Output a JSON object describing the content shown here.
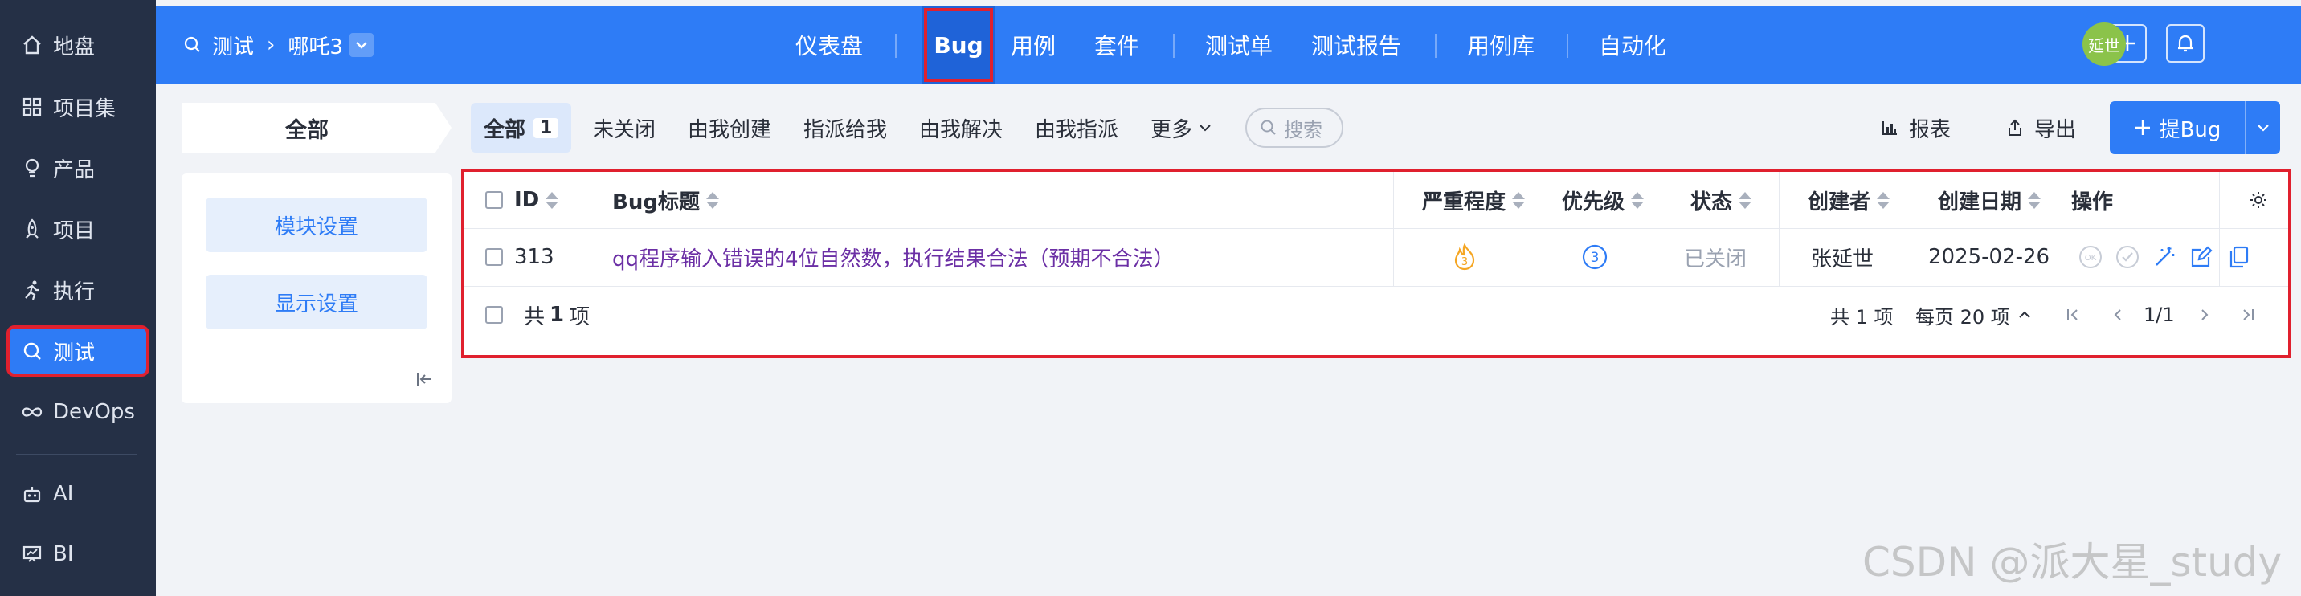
{
  "sidebar": {
    "items": [
      {
        "label": "地盘",
        "icon": "home-icon"
      },
      {
        "label": "项目集",
        "icon": "grid-icon"
      },
      {
        "label": "产品",
        "icon": "bulb-icon"
      },
      {
        "label": "项目",
        "icon": "rocket-icon"
      },
      {
        "label": "执行",
        "icon": "run-icon"
      },
      {
        "label": "测试",
        "icon": "search-icon",
        "active": true
      },
      {
        "label": "DevOps",
        "icon": "infinity-icon"
      },
      {
        "label": "AI",
        "icon": "robot-icon"
      },
      {
        "label": "BI",
        "icon": "chart-board-icon"
      }
    ]
  },
  "topbar": {
    "breadcrumb": {
      "section": "测试",
      "product": "哪吒3"
    },
    "nav": [
      "仪表盘",
      "Bug",
      "用例",
      "套件",
      "测试单",
      "测试报告",
      "用例库",
      "自动化"
    ],
    "active_nav": "Bug",
    "avatar_text": "延世"
  },
  "filterbar": {
    "all_label": "全部",
    "tabs": [
      {
        "label": "全部",
        "count": "1",
        "active": true
      },
      {
        "label": "未关闭"
      },
      {
        "label": "由我创建"
      },
      {
        "label": "指派给我"
      },
      {
        "label": "由我解决"
      },
      {
        "label": "由我指派"
      },
      {
        "label": "更多"
      }
    ],
    "search_placeholder": "搜索",
    "report_label": "报表",
    "export_label": "导出",
    "add_bug_label": "提Bug"
  },
  "leftpanel": {
    "module_settings": "模块设置",
    "display_settings": "显示设置"
  },
  "table": {
    "columns": [
      "ID",
      "Bug标题",
      "严重程度",
      "优先级",
      "状态",
      "创建者",
      "创建日期",
      "操作"
    ],
    "rows": [
      {
        "id": "313",
        "title": "qq程序输入错误的4位自然数，执行结果合法（预期不合法）",
        "severity": "3",
        "priority": "3",
        "status": "已关闭",
        "creator": "张延世",
        "date": "2025-02-26"
      }
    ],
    "footer_total": "共 1 项",
    "footer_count_left": {
      "prefix": "共 ",
      "num": "1",
      "suffix": " 项"
    },
    "pager": {
      "total": "共 1 项",
      "per_page": "每页 20 项",
      "page": "1/1"
    }
  },
  "colors": {
    "primary": "#2e7cf6",
    "sidebar": "#253046",
    "highlight": "#e0202e",
    "title_link": "#6b2fa5"
  },
  "watermark": "CSDN @派大星_study"
}
